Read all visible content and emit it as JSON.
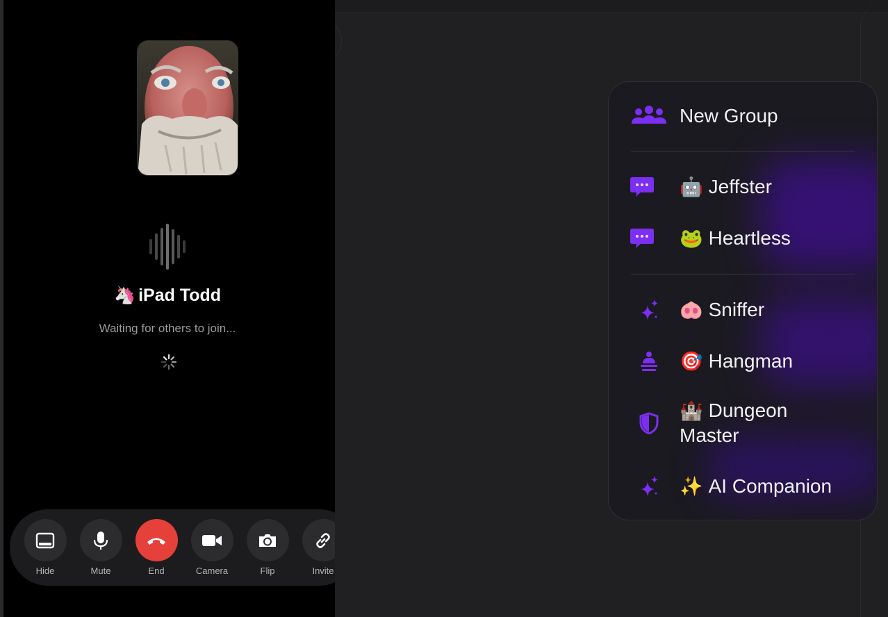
{
  "call": {
    "caller_emoji": "🦄",
    "caller_name": "iPad Todd",
    "status": "Waiting for others to join...",
    "icons": {
      "waveform": "waveform-icon",
      "spinner": "spinner-icon"
    }
  },
  "controls": [
    {
      "label": "Hide",
      "icon": "hide-icon"
    },
    {
      "label": "Mute",
      "icon": "microphone-icon"
    },
    {
      "label": "End",
      "icon": "end-call-icon"
    },
    {
      "label": "Camera",
      "icon": "video-camera-icon"
    },
    {
      "label": "Flip",
      "icon": "flip-camera-icon"
    },
    {
      "label": "Invite",
      "icon": "link-icon"
    }
  ],
  "menu": {
    "new_group": {
      "label": "New Group",
      "icon": "people-group-icon"
    },
    "chats": [
      {
        "emoji": "🤖",
        "name": "Jeffster",
        "icon": "chat-bubble-icon"
      },
      {
        "emoji": "🐸",
        "name": "Heartless",
        "icon": "chat-bubble-icon"
      }
    ],
    "ai": [
      {
        "emoji": "🐽",
        "name": "Sniffer",
        "icon": "sparkles-icon"
      },
      {
        "emoji": "🎯",
        "name": "Hangman",
        "icon": "game-host-icon"
      },
      {
        "emoji": "🏰",
        "name_line1": "Dungeon",
        "name_line2": "Master",
        "icon": "shield-icon"
      },
      {
        "emoji": "✨",
        "name": "AI Companion",
        "icon": "sparkles-icon"
      }
    ]
  },
  "colors": {
    "accent": "#6a1de0",
    "end_call": "#e5403a",
    "panel": "#000000",
    "menu_bg": "#1b1a20"
  }
}
